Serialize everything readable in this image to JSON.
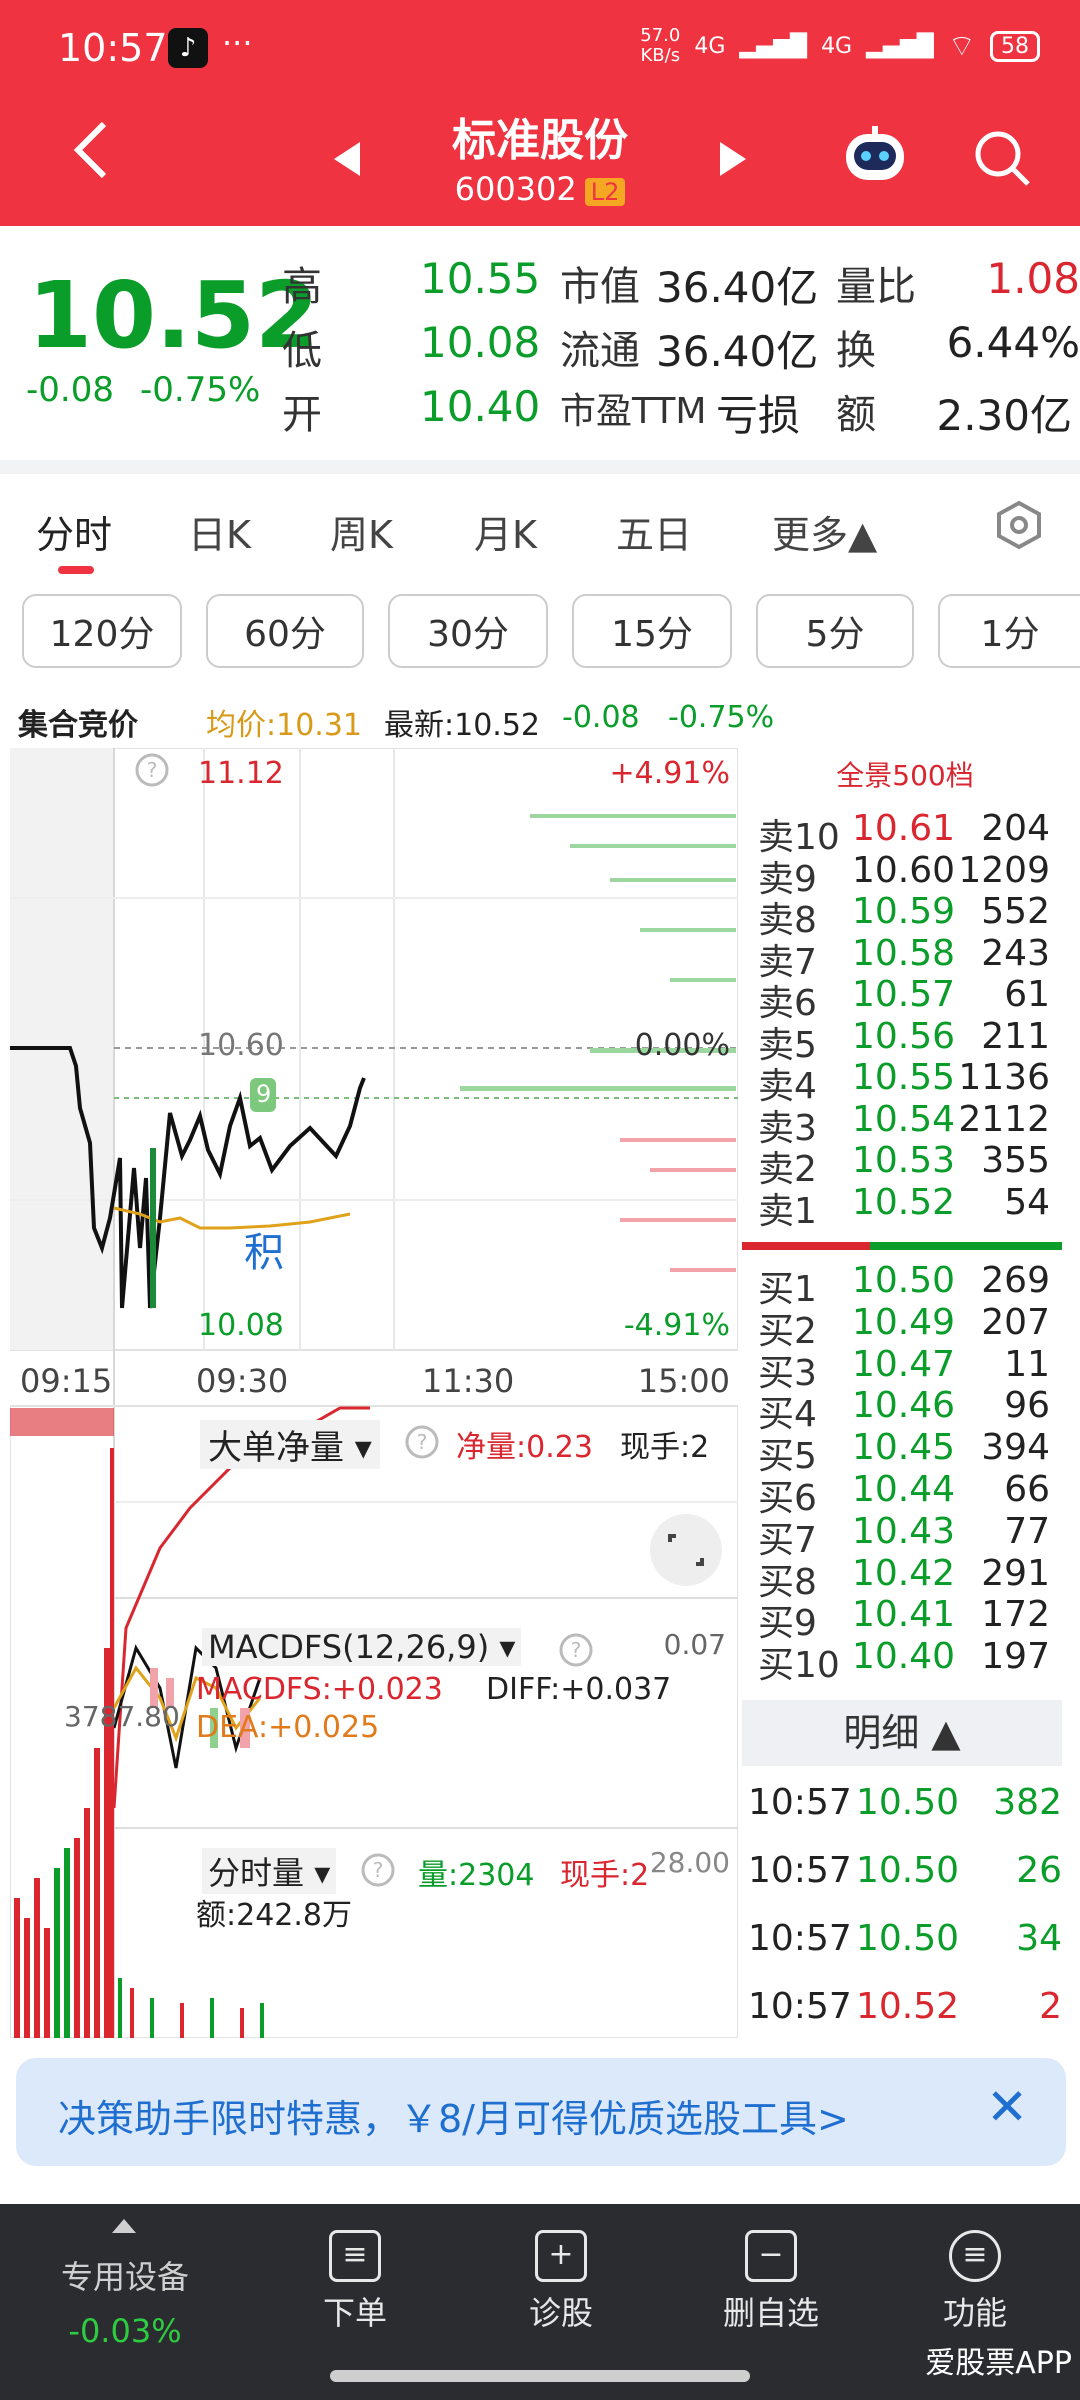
{
  "status": {
    "time": "10:57",
    "net_speed": "57.0",
    "net_unit": "KB/s",
    "net_a": "4G",
    "net_b": "4G",
    "battery": "58"
  },
  "header": {
    "title": "标准股份",
    "code": "600302",
    "level": "L2"
  },
  "quote": {
    "price": "10.52",
    "change": "-0.08",
    "change_pct": "-0.75%",
    "high_label": "高",
    "high": "10.55",
    "low_label": "低",
    "low": "10.08",
    "open_label": "开",
    "open": "10.40",
    "mcap_label": "市值",
    "mcap": "36.40亿",
    "float_label": "流通",
    "float": "36.40亿",
    "pe_label": "市盈TTM",
    "pe": "亏损",
    "vol_ratio_label": "量比",
    "vol_ratio": "1.08",
    "turnover_label": "换",
    "turnover": "6.44%",
    "amount_label": "额",
    "amount": "2.30亿"
  },
  "tabs": [
    "分时",
    "日K",
    "周K",
    "月K",
    "五日",
    "更多▲"
  ],
  "periods": [
    "120分",
    "60分",
    "30分",
    "15分",
    "5分",
    "1分"
  ],
  "info": {
    "auction": "集合竞价",
    "avg": "均价:10.31",
    "latest": "最新:10.52",
    "chg": "-0.08",
    "chg_pct": "-0.75%"
  },
  "chart": {
    "top_price": "11.12",
    "top_pct": "+4.91%",
    "mid_price": "10.60",
    "mid_pct": "0.00%",
    "bottom_price": "10.08",
    "bottom_pct": "-4.91%",
    "marker": "9",
    "jiji": "积",
    "times": [
      "09:15",
      "09:30",
      "11:30",
      "15:00"
    ],
    "big_order_label": "大单净量",
    "net_label": "净量:0.23",
    "now_label": "现手:2",
    "big_order_value": "3787.80",
    "macd_label": "MACDFS(12,26,9)",
    "macd_top": "0.07",
    "macdfs": "MACDFS:+0.023",
    "diff": "DIFF:+0.037",
    "dea": "DEA:+0.025",
    "vol_label": "分时量",
    "vol": "量:2304",
    "vol_now": "现手:2",
    "vol_top": "28.00",
    "amount": "额:242.8万"
  },
  "orderbook": {
    "title": "全景500档",
    "sells": [
      {
        "label": "卖10",
        "price": "10.61",
        "vol": "204",
        "c": "red"
      },
      {
        "label": "卖9",
        "price": "10.60",
        "vol": "1209",
        "c": "grey"
      },
      {
        "label": "卖8",
        "price": "10.59",
        "vol": "552",
        "c": "green"
      },
      {
        "label": "卖7",
        "price": "10.58",
        "vol": "243",
        "c": "green"
      },
      {
        "label": "卖6",
        "price": "10.57",
        "vol": "61",
        "c": "green"
      },
      {
        "label": "卖5",
        "price": "10.56",
        "vol": "211",
        "c": "green"
      },
      {
        "label": "卖4",
        "price": "10.55",
        "vol": "1136",
        "c": "green"
      },
      {
        "label": "卖3",
        "price": "10.54",
        "vol": "2112",
        "c": "green"
      },
      {
        "label": "卖2",
        "price": "10.53",
        "vol": "355",
        "c": "green"
      },
      {
        "label": "卖1",
        "price": "10.52",
        "vol": "54",
        "c": "green"
      }
    ],
    "buys": [
      {
        "label": "买1",
        "price": "10.50",
        "vol": "269",
        "c": "green"
      },
      {
        "label": "买2",
        "price": "10.49",
        "vol": "207",
        "c": "green"
      },
      {
        "label": "买3",
        "price": "10.47",
        "vol": "11",
        "c": "green"
      },
      {
        "label": "买4",
        "price": "10.46",
        "vol": "96",
        "c": "green"
      },
      {
        "label": "买5",
        "price": "10.45",
        "vol": "394",
        "c": "green"
      },
      {
        "label": "买6",
        "price": "10.44",
        "vol": "66",
        "c": "green"
      },
      {
        "label": "买7",
        "price": "10.43",
        "vol": "77",
        "c": "green"
      },
      {
        "label": "买8",
        "price": "10.42",
        "vol": "291",
        "c": "green"
      },
      {
        "label": "买9",
        "price": "10.41",
        "vol": "172",
        "c": "green"
      },
      {
        "label": "买10",
        "price": "10.40",
        "vol": "197",
        "c": "green"
      }
    ]
  },
  "detail": {
    "title": "明细 ▲",
    "rows": [
      {
        "time": "10:57",
        "price": "10.50",
        "vol": "382",
        "c": "green"
      },
      {
        "time": "10:57",
        "price": "10.50",
        "vol": "26",
        "c": "green"
      },
      {
        "time": "10:57",
        "price": "10.50",
        "vol": "34",
        "c": "green"
      },
      {
        "time": "10:57",
        "price": "10.52",
        "vol": "2",
        "c": "red"
      }
    ]
  },
  "promo": {
    "text": "决策助手限时特惠，￥8/月可得优质选股工具>",
    "close": "✕"
  },
  "bottom": {
    "device": "专用设备",
    "device_pct": "-0.03%",
    "order": "下单",
    "diagnose": "诊股",
    "remove": "删自选",
    "func": "功能",
    "watermark": "爱股票APP"
  },
  "colors": {
    "brand": "#ef3340",
    "up": "#d9262f",
    "down": "#0a9d2a"
  }
}
